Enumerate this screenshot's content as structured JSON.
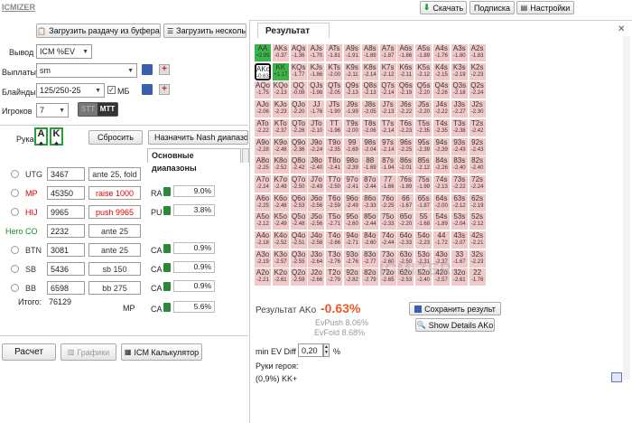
{
  "header": {
    "logo": "ICMIZER",
    "download": "Скачать",
    "subscription": "Подписка",
    "settings": "Настройки"
  },
  "toolbar": {
    "load_buffer": "Загрузить раздачу из буфера",
    "load_several": "Загрузить нескольк"
  },
  "form": {
    "output_label": "Вывод",
    "output_value": "ICM %EV",
    "payouts_label": "Выплаты",
    "payouts_value": "sm",
    "blinds_label": "Блайнды",
    "blinds_value": "125/250-25",
    "mb_label": "МБ",
    "players_label": "Игроков",
    "players_value": "7",
    "mtt_label": "MTT",
    "stt_label": "STT"
  },
  "hand": {
    "label": "Рука",
    "card1": "A",
    "card2": "K",
    "reset": "Сбросить",
    "assign_nash": "Назначить Nash диапазоны",
    "ranges_tab": "Основные диапазоны"
  },
  "players": [
    {
      "pos": "UTG",
      "stack": "3467",
      "action": "ante 25, fold",
      "action_color": "#333",
      "pct": ""
    },
    {
      "pos": "MP",
      "stack": "45350",
      "action": "raise 1000",
      "action_color": "#d00",
      "pct": "9.0%"
    },
    {
      "pos": "HIJ",
      "stack": "9965",
      "action": "push 9965",
      "action_color": "#d00",
      "pct": "3.8%"
    },
    {
      "pos": "Hero CO",
      "stack": "2232",
      "action": "ante 25",
      "action_color": "#333",
      "pct": ""
    },
    {
      "pos": "BTN",
      "stack": "3081",
      "action": "ante 25",
      "action_color": "#333",
      "pct": "0.9%"
    },
    {
      "pos": "SB",
      "stack": "5436",
      "action": "sb 150",
      "action_color": "#333",
      "pct": "0.9%"
    },
    {
      "pos": "BB",
      "stack": "6598",
      "action": "bb 275",
      "action_color": "#333",
      "pct": "0.9%"
    }
  ],
  "pct_labels": {
    "ra": "RA",
    "pu": "PU",
    "ca": "CA"
  },
  "extra_pct": "5.6%",
  "total_label": "Итого:",
  "total_value": "76129",
  "mp_label": "MP",
  "bottom": {
    "calc": "Расчет",
    "graphs": "Графики",
    "icm_calc": "ICM Калькулятор"
  },
  "result": {
    "tab": "Результат",
    "summary_label": "Результат AKo",
    "summary_value": "-0.63%",
    "evpush": "EvPush 8.06%",
    "evfold": "EvFold 8.68%",
    "save": "Сохранить результ",
    "show_details": "Show Details AKo",
    "min_ev_label": "min EV Diff",
    "min_ev_value": "0,20",
    "min_ev_unit": "%",
    "hero_hands_label": "Руки героя:",
    "hero_hands_value": "(0,9%) KK+",
    "watermark": "ICMIZER"
  },
  "matrix": [
    [
      "AA",
      "+2.99",
      "AKs",
      "-0.37",
      "AQs",
      "-1.36",
      "AJs",
      "-1.70",
      "ATs",
      "-1.81",
      "A9s",
      "-1.91",
      "A8s",
      "-1.89",
      "A7s",
      "-1.87",
      "A6s",
      "-1.86",
      "A5s",
      "-1.89",
      "A4s",
      "-1.76",
      "A3s",
      "-1.80",
      "A2s",
      "-1.83"
    ],
    [
      "AKo",
      "-0.63",
      "KK",
      "+1.17",
      "KQs",
      "-1.77",
      "KJs",
      "-1.86",
      "KTs",
      "-2.00",
      "K9s",
      "-2.11",
      "K8s",
      "-2.14",
      "K7s",
      "-2.12",
      "K6s",
      "-2.11",
      "K5s",
      "-2.12",
      "K4s",
      "-2.15",
      "K3s",
      "-2.19",
      "K2s",
      "-2.23"
    ],
    [
      "AQo",
      "-1.75",
      "KQo",
      "-2.13",
      "QQ",
      "-0.08",
      "QJs",
      "-1.98",
      "QTs",
      "-2.05",
      "Q9s",
      "-2.13",
      "Q8s",
      "-2.13",
      "Q7s",
      "-2.14",
      "Q6s",
      "-2.19",
      "Q5s",
      "-2.20",
      "Q4s",
      "-2.26",
      "Q3s",
      "-2.18",
      "Q2s",
      "-2.24"
    ],
    [
      "AJo",
      "-2.06",
      "KJo",
      "-2.23",
      "QJo",
      "-2.20",
      "JJ",
      "-1.76",
      "JTs",
      "-1.90",
      "J9s",
      "-1.99",
      "J8s",
      "-2.05",
      "J7s",
      "-2.13",
      "J6s",
      "-2.22",
      "J5s",
      "-2.20",
      "J4s",
      "-2.22",
      "J3s",
      "-2.27",
      "J2s",
      "-2.30"
    ],
    [
      "ATo",
      "-2.22",
      "KTo",
      "-2.37",
      "QTo",
      "-2.26",
      "JTo",
      "-2.10",
      "TT",
      "-1.96",
      "T9s",
      "-2.00",
      "T8s",
      "-2.06",
      "T7s",
      "-2.14",
      "T6s",
      "-2.23",
      "T5s",
      "-2.35",
      "T4s",
      "-2.35",
      "T3s",
      "-2.38",
      "T2s",
      "-2.42"
    ],
    [
      "A9o",
      "-2.28",
      "K9o",
      "-2.48",
      "Q9o",
      "-2.36",
      "J9o",
      "-2.24",
      "T9o",
      "-2.35",
      "99",
      "-1.69",
      "98s",
      "-2.04",
      "97s",
      "-2.14",
      "96s",
      "-2.25",
      "95s",
      "-2.39",
      "94s",
      "-2.39",
      "93s",
      "-2.43",
      "92s",
      "-2.43"
    ],
    [
      "A8o",
      "-2.25",
      "K8o",
      "-2.52",
      "Q8o",
      "-2.42",
      "J8o",
      "-2.40",
      "T8o",
      "-2.41",
      "98o",
      "-2.39",
      "88",
      "-1.69",
      "87s",
      "-1.94",
      "86s",
      "-2.01",
      "85s",
      "-2.12",
      "84s",
      "-2.26",
      "83s",
      "-2.40",
      "82s",
      "-2.40"
    ],
    [
      "A7o",
      "-2.24",
      "K7o",
      "-2.49",
      "Q7o",
      "-2.50",
      "J7o",
      "-2.49",
      "T7o",
      "-2.50",
      "97o",
      "-2.41",
      "87o",
      "-2.44",
      "77",
      "-1.66",
      "76s",
      "-1.89",
      "75s",
      "-1.99",
      "74s",
      "-2.13",
      "73s",
      "-2.22",
      "72s",
      "-2.24"
    ],
    [
      "A6o",
      "-2.25",
      "K6o",
      "-2.48",
      "Q6o",
      "-2.53",
      "J6o",
      "-2.56",
      "T6o",
      "-2.59",
      "96o",
      "-2.49",
      "86o",
      "-2.33",
      "76o",
      "-2.25",
      "66",
      "-1.67",
      "65s",
      "-1.87",
      "64s",
      "-2.00",
      "63s",
      "-2.12",
      "62s",
      "-2.19"
    ],
    [
      "A5o",
      "-2.12",
      "K5o",
      "-2.49",
      "Q5o",
      "-2.48",
      "J5o",
      "-2.56",
      "T5o",
      "-2.71",
      "95o",
      "-2.60",
      "85o",
      "-2.44",
      "75o",
      "-2.33",
      "65o",
      "-2.20",
      "55",
      "-1.68",
      "54s",
      "-1.89",
      "53s",
      "-2.04",
      "52s",
      "-2.12"
    ],
    [
      "A4o",
      "-2.18",
      "K4o",
      "-2.52",
      "Q4o",
      "-2.51",
      "J4o",
      "-2.58",
      "T4o",
      "-2.66",
      "94o",
      "-2.71",
      "84o",
      "-2.60",
      "74o",
      "-2.44",
      "64o",
      "-2.33",
      "54o",
      "-2.23",
      "44",
      "-1.72",
      "43s",
      "-2.07",
      "42s",
      "-2.21"
    ],
    [
      "A3o",
      "-2.19",
      "K3o",
      "-2.57",
      "Q3o",
      "-2.55",
      "J3o",
      "-2.64",
      "T3o",
      "-2.76",
      "93o",
      "-2.76",
      "83o",
      "-2.77",
      "73o",
      "-2.60",
      "63o",
      "-2.50",
      "53o",
      "-2.31",
      "43o",
      "-2.37",
      "33",
      "-1.67",
      "32s",
      "-2.23"
    ],
    [
      "A2o",
      "-2.21",
      "K2o",
      "-2.61",
      "Q2o",
      "-2.59",
      "J2o",
      "-2.66",
      "T2o",
      "-2.79",
      "92o",
      "-2.82",
      "82o",
      "-2.79",
      "72o",
      "-2.65",
      "62o",
      "-2.53",
      "52o",
      "-2.40",
      "42o",
      "-2.57",
      "32o",
      "-2.61",
      "22",
      "-1.76"
    ]
  ],
  "colors": {
    "accent": "#e85a2a",
    "positive": "#3bb54a",
    "cell_neg": "#f2c9c9",
    "cell_tab": "#fde9d9",
    "hero_green": "#1a8a2a"
  }
}
